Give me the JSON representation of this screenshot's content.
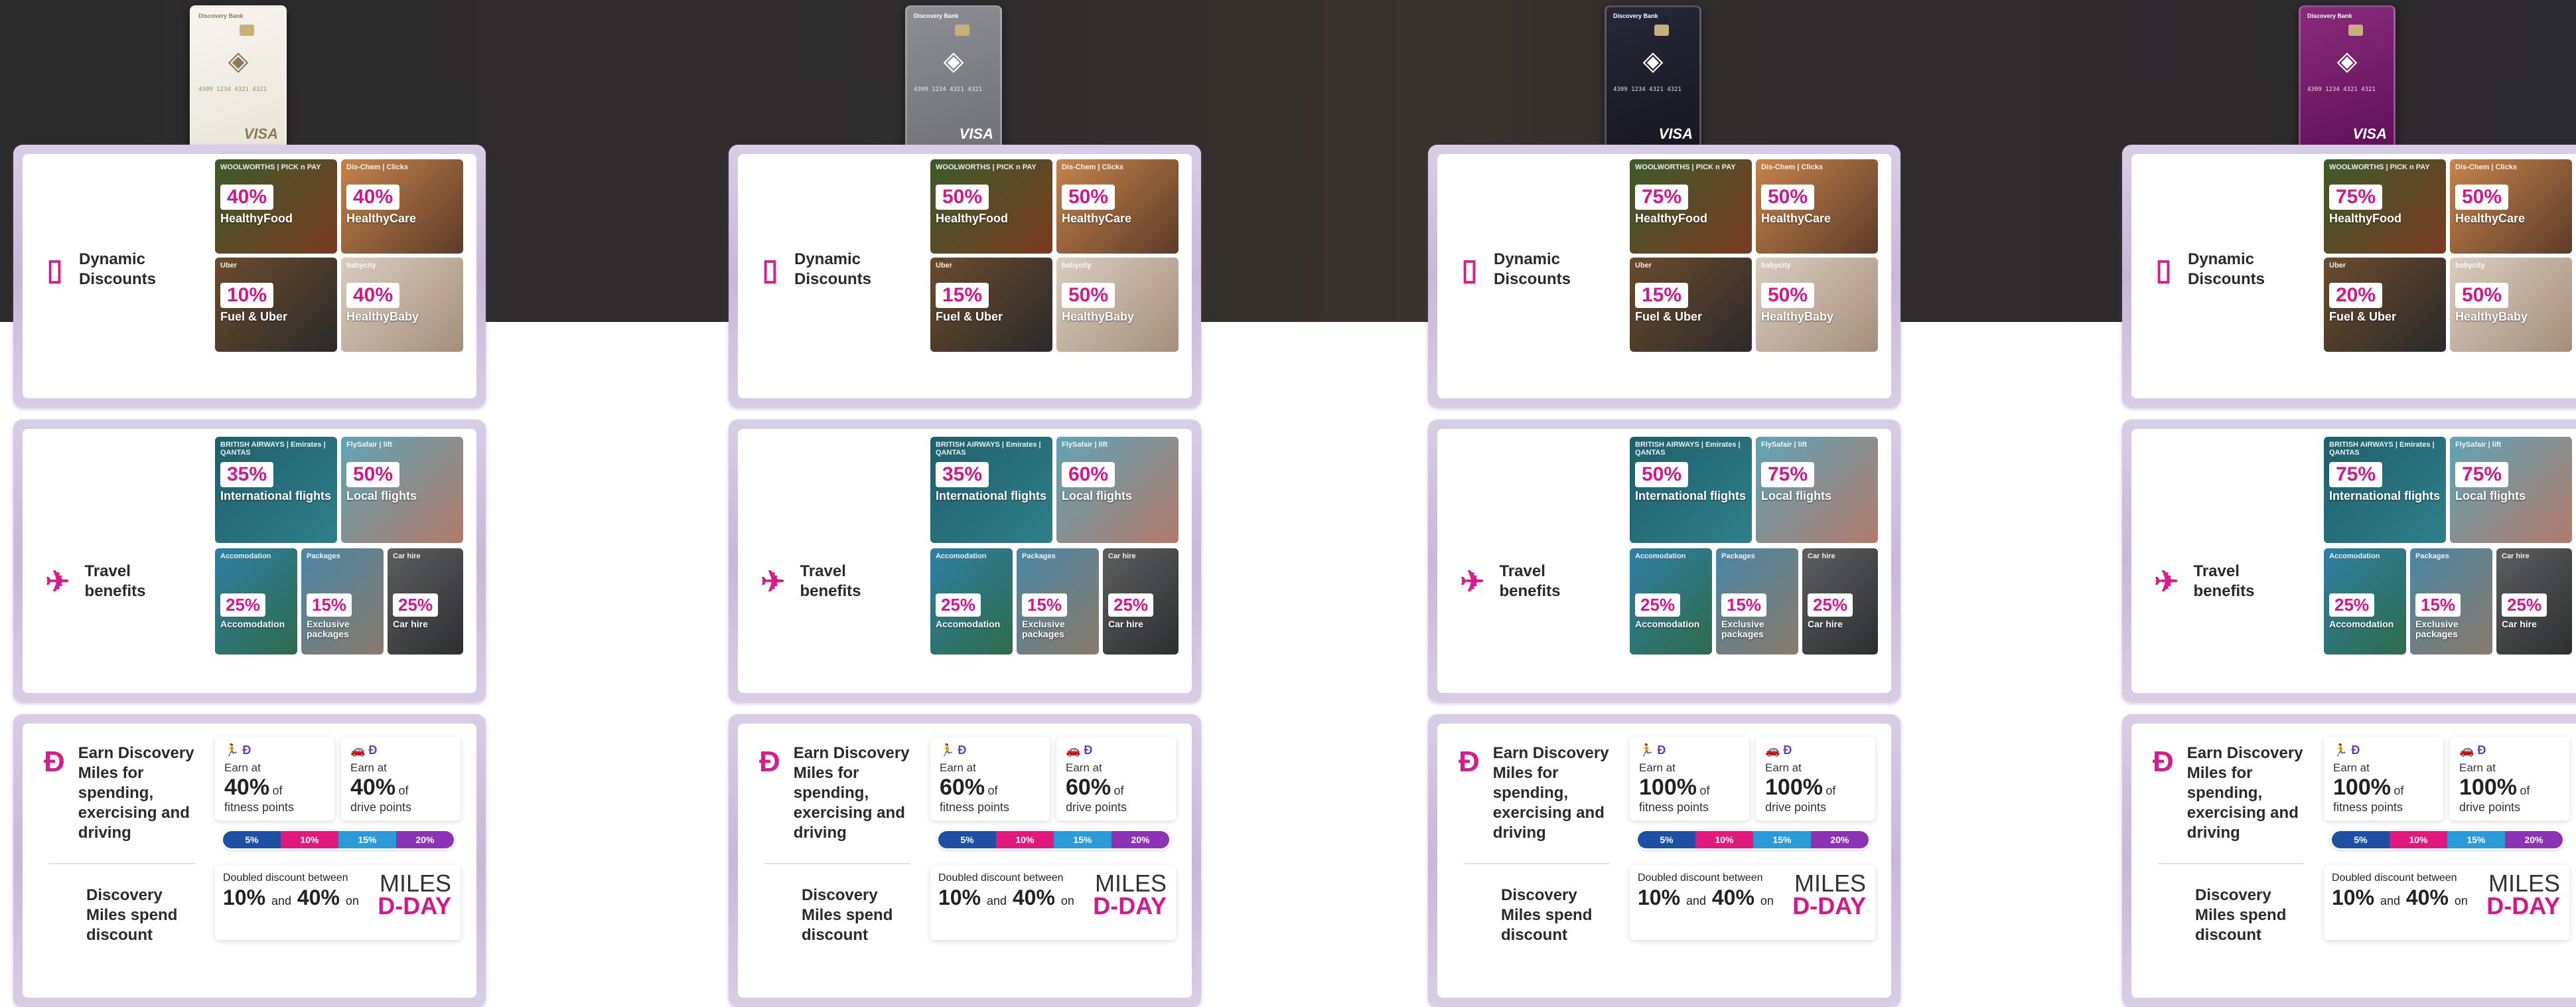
{
  "colors": {
    "accent": "#d6168b",
    "panel": "#d1c2e0",
    "hero": "#2c2b2c"
  },
  "columns": [
    {
      "card_tier": "gold",
      "card": {
        "bank": "Discovery Bank",
        "number": "4309 1234 4321 4321",
        "network": "VISA"
      },
      "dynamic": {
        "label": "Dynamic Discounts",
        "icon": "phone-discount-icon",
        "tiles": [
          {
            "pct": "40%",
            "name": "HealthyFood",
            "brand": "WOOLWORTHS | PICK n PAY"
          },
          {
            "pct": "40%",
            "name": "HealthyCare",
            "brand": "Dis-Chem | Clicks"
          },
          {
            "pct": "10%",
            "name": "Fuel & Uber",
            "brand": "Uber"
          },
          {
            "pct": "40%",
            "name": "HealthyBaby",
            "brand": "babycity"
          }
        ]
      },
      "travel": {
        "label": "Travel benefits",
        "icon": "plane-icon",
        "tiles": [
          {
            "pct": "35%",
            "name": "International flights",
            "brand": "BRITISH AIRWAYS | Emirates | QANTAS"
          },
          {
            "pct": "50%",
            "name": "Local flights",
            "brand": "FlySafair | lift"
          },
          {
            "pct": "25%",
            "name": "Accomodation",
            "brand": "Accomodation"
          },
          {
            "pct": "15%",
            "name": "Exclusive packages",
            "brand": "Packages"
          },
          {
            "pct": "25%",
            "name": "Car hire",
            "brand": "Car hire"
          }
        ]
      },
      "miles": {
        "label": "Earn Discovery Miles for spending, exercising and driving",
        "fitness": {
          "earn_at": "Earn at",
          "value": "40%",
          "of": "of",
          "type": "fitness points"
        },
        "drive": {
          "earn_at": "Earn at",
          "value": "40%",
          "of": "of",
          "type": "drive points"
        },
        "bar": [
          "5%",
          "10%",
          "15%",
          "20%"
        ],
        "spend_label": "Discovery Miles spend discount",
        "doubled": {
          "label": "Doubled discount between",
          "low": "10%",
          "and": "and",
          "high": "40%",
          "on": "on"
        },
        "mday": {
          "line1": "MILES",
          "line2": "D-DAY"
        }
      }
    },
    {
      "card_tier": "platinum",
      "card": {
        "bank": "Discovery Bank",
        "number": "4309 1234 4321 4321",
        "network": "VISA"
      },
      "dynamic": {
        "label": "Dynamic Discounts",
        "icon": "phone-discount-icon",
        "tiles": [
          {
            "pct": "50%",
            "name": "HealthyFood",
            "brand": "WOOLWORTHS | PICK n PAY"
          },
          {
            "pct": "50%",
            "name": "HealthyCare",
            "brand": "Dis-Chem | Clicks"
          },
          {
            "pct": "15%",
            "name": "Fuel & Uber",
            "brand": "Uber"
          },
          {
            "pct": "50%",
            "name": "HealthyBaby",
            "brand": "babycity"
          }
        ]
      },
      "travel": {
        "label": "Travel benefits",
        "icon": "plane-icon",
        "tiles": [
          {
            "pct": "35%",
            "name": "International flights",
            "brand": "BRITISH AIRWAYS | Emirates | QANTAS"
          },
          {
            "pct": "60%",
            "name": "Local flights",
            "brand": "FlySafair | lift"
          },
          {
            "pct": "25%",
            "name": "Accomodation",
            "brand": "Accomodation"
          },
          {
            "pct": "15%",
            "name": "Exclusive packages",
            "brand": "Packages"
          },
          {
            "pct": "25%",
            "name": "Car hire",
            "brand": "Car hire"
          }
        ]
      },
      "miles": {
        "label": "Earn Discovery Miles for spending, exercising and driving",
        "fitness": {
          "earn_at": "Earn at",
          "value": "60%",
          "of": "of",
          "type": "fitness points"
        },
        "drive": {
          "earn_at": "Earn at",
          "value": "60%",
          "of": "of",
          "type": "drive points"
        },
        "bar": [
          "5%",
          "10%",
          "15%",
          "20%"
        ],
        "spend_label": "Discovery Miles spend discount",
        "doubled": {
          "label": "Doubled discount between",
          "low": "10%",
          "and": "and",
          "high": "40%",
          "on": "on"
        },
        "mday": {
          "line1": "MILES",
          "line2": "D-DAY"
        }
      }
    },
    {
      "card_tier": "black",
      "card": {
        "bank": "Discovery Bank",
        "number": "4309 1234 4321 4321",
        "network": "VISA"
      },
      "dynamic": {
        "label": "Dynamic Discounts",
        "icon": "phone-discount-icon",
        "tiles": [
          {
            "pct": "75%",
            "name": "HealthyFood",
            "brand": "WOOLWORTHS | PICK n PAY"
          },
          {
            "pct": "50%",
            "name": "HealthyCare",
            "brand": "Dis-Chem | Clicks"
          },
          {
            "pct": "15%",
            "name": "Fuel & Uber",
            "brand": "Uber"
          },
          {
            "pct": "50%",
            "name": "HealthyBaby",
            "brand": "babycity"
          }
        ]
      },
      "travel": {
        "label": "Travel benefits",
        "icon": "plane-icon",
        "tiles": [
          {
            "pct": "50%",
            "name": "International flights",
            "brand": "BRITISH AIRWAYS | Emirates | QANTAS"
          },
          {
            "pct": "75%",
            "name": "Local flights",
            "brand": "FlySafair | lift"
          },
          {
            "pct": "25%",
            "name": "Accomodation",
            "brand": "Accomodation"
          },
          {
            "pct": "15%",
            "name": "Exclusive packages",
            "brand": "Packages"
          },
          {
            "pct": "25%",
            "name": "Car hire",
            "brand": "Car hire"
          }
        ]
      },
      "miles": {
        "label": "Earn Discovery Miles for spending, exercising and driving",
        "fitness": {
          "earn_at": "Earn at",
          "value": "100%",
          "of": "of",
          "type": "fitness points"
        },
        "drive": {
          "earn_at": "Earn at",
          "value": "100%",
          "of": "of",
          "type": "drive points"
        },
        "bar": [
          "5%",
          "10%",
          "15%",
          "20%"
        ],
        "spend_label": "Discovery Miles spend discount",
        "doubled": {
          "label": "Doubled discount between",
          "low": "10%",
          "and": "and",
          "high": "40%",
          "on": "on"
        },
        "mday": {
          "line1": "MILES",
          "line2": "D-DAY"
        }
      }
    },
    {
      "card_tier": "purple",
      "card": {
        "bank": "Discovery Bank",
        "number": "4309 1234 4321 4321",
        "network": "VISA"
      },
      "dynamic": {
        "label": "Dynamic Discounts",
        "icon": "phone-discount-icon",
        "tiles": [
          {
            "pct": "75%",
            "name": "HealthyFood",
            "brand": "WOOLWORTHS | PICK n PAY"
          },
          {
            "pct": "50%",
            "name": "HealthyCare",
            "brand": "Dis-Chem | Clicks"
          },
          {
            "pct": "20%",
            "name": "Fuel & Uber",
            "brand": "Uber"
          },
          {
            "pct": "50%",
            "name": "HealthyBaby",
            "brand": "babycity"
          }
        ]
      },
      "travel": {
        "label": "Travel benefits",
        "icon": "plane-icon",
        "tiles": [
          {
            "pct": "75%",
            "name": "International flights",
            "brand": "BRITISH AIRWAYS | Emirates | QANTAS"
          },
          {
            "pct": "75%",
            "name": "Local flights",
            "brand": "FlySafair | lift"
          },
          {
            "pct": "25%",
            "name": "Accomodation",
            "brand": "Accomodation"
          },
          {
            "pct": "15%",
            "name": "Exclusive packages",
            "brand": "Packages"
          },
          {
            "pct": "25%",
            "name": "Car hire",
            "brand": "Car hire"
          }
        ]
      },
      "miles": {
        "label": "Earn Discovery Miles for spending, exercising and driving",
        "fitness": {
          "earn_at": "Earn at",
          "value": "100%",
          "of": "of",
          "type": "fitness points"
        },
        "drive": {
          "earn_at": "Earn at",
          "value": "100%",
          "of": "of",
          "type": "drive points"
        },
        "bar": [
          "5%",
          "10%",
          "15%",
          "20%"
        ],
        "spend_label": "Discovery Miles spend discount",
        "doubled": {
          "label": "Doubled discount between",
          "low": "10%",
          "and": "and",
          "high": "40%",
          "on": "on"
        },
        "mday": {
          "line1": "MILES",
          "line2": "D-DAY"
        }
      }
    }
  ]
}
